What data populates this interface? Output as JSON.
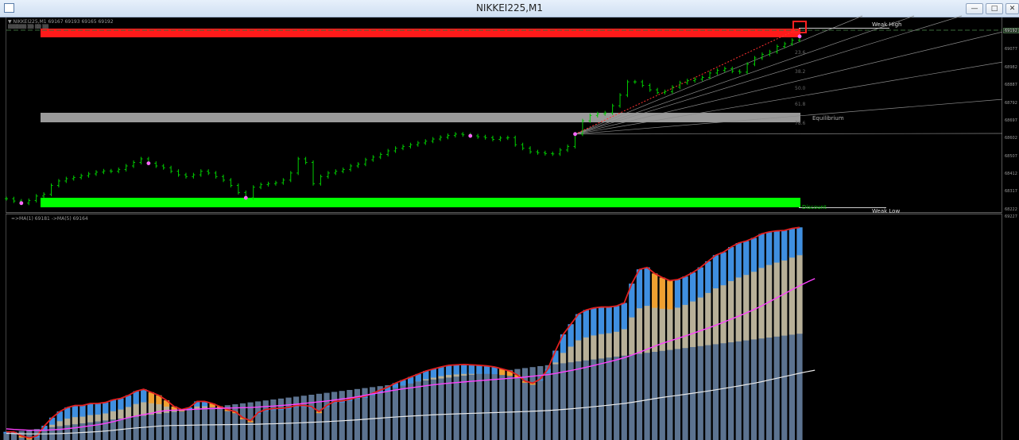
{
  "window": {
    "title": "NIKKEI225,M1"
  },
  "info_line": "▼ NIKKEI225,M1  69167 69193 69165 69192",
  "info_line2": "▒▒▒▒▒▒  ▒▒  ▒▒ ▒▒",
  "indicator_info": "=>MA(1) 69181  ->MA(5) 69164",
  "zones": {
    "weak_high": "Weak High",
    "equilibrium": "Equilibrium",
    "discount": "Discount",
    "weak_low": "Weak Low"
  },
  "fib_levels": [
    "23.6",
    "38.2",
    "50.0",
    "61.8",
    "78.6"
  ],
  "price_axis": {
    "current": "69192",
    "ticks": [
      "69172",
      "69077",
      "68982",
      "68887",
      "68792",
      "68697",
      "68602",
      "68507",
      "68412",
      "68317",
      "68222",
      "69227"
    ]
  },
  "colors": {
    "supply_zone": "#ff1a1a",
    "equilibrium_zone": "#9a9a9a",
    "demand_zone": "#00ff00",
    "candles": "#00cc00",
    "pivot": "#ff66ff",
    "fib_ray": "#aaaaaa",
    "hist_blue": "#3f8fe0",
    "hist_khaki": "#b8b098",
    "hist_steel": "#5c7390",
    "hist_orange": "#f0a030",
    "ma_red": "#e02020",
    "ma_magenta": "#ff40ff",
    "ma_white": "#e8e8e8"
  },
  "chart_data": {
    "type": "line",
    "price_pane": {
      "series": [
        {
          "values": [
            68275,
            68262,
            68250,
            68265,
            68290,
            68300,
            68350,
            68375,
            68388,
            68395,
            68405,
            68415,
            68425,
            68432,
            68430,
            68440,
            68460,
            68480,
            68500,
            68475,
            68460,
            68450,
            68430,
            68410,
            68400,
            68410,
            68430,
            68420,
            68400,
            68380,
            68350,
            68310,
            68280,
            68340,
            68355,
            68360,
            68365,
            68380,
            68420,
            68500,
            68480,
            68360,
            68400,
            68420,
            68430,
            68440,
            68460,
            68470,
            68495,
            68510,
            68525,
            68545,
            68560,
            68570,
            68580,
            68590,
            68600,
            68612,
            68622,
            68632,
            68640,
            68636,
            68630,
            68625,
            68620,
            68610,
            68618,
            68620,
            68580,
            68560,
            68540,
            68535,
            68530,
            68528,
            68550,
            68570,
            68640,
            68715,
            68745,
            68755,
            68760,
            68800,
            68860,
            68935,
            68935,
            68915,
            68890,
            68875,
            68880,
            68905,
            68930,
            68942,
            68950,
            68960,
            68985,
            69000,
            69010,
            68995,
            68990,
            69035,
            69070,
            69090,
            69105,
            69135,
            69150,
            69170,
            69192
          ]
        }
      ]
    },
    "indicator_pane": {
      "series": [
        {
          "name": "MA(1)",
          "values": [
            68220,
            68220,
            68200,
            68190,
            68200,
            68250,
            68290,
            68320,
            68340,
            68350,
            68350,
            68360,
            68360,
            68365,
            68378,
            68385,
            68400,
            68420,
            68430,
            68415,
            68400,
            68375,
            68345,
            68330,
            68340,
            68370,
            68370,
            68360,
            68345,
            68330,
            68320,
            68290,
            68275,
            68315,
            68330,
            68335,
            68336,
            68340,
            68350,
            68350,
            68345,
            68320,
            68350,
            68370,
            68372,
            68380,
            68390,
            68395,
            68410,
            68425,
            68440,
            68460,
            68475,
            68490,
            68505,
            68520,
            68530,
            68540,
            68548,
            68550,
            68552,
            68550,
            68548,
            68545,
            68540,
            68530,
            68520,
            68500,
            68470,
            68460,
            68480,
            68530,
            68620,
            68700,
            68750,
            68800,
            68820,
            68830,
            68835,
            68835,
            68840,
            68855,
            68950,
            69020,
            69030,
            69000,
            68980,
            68965,
            68970,
            68985,
            69005,
            69030,
            69060,
            69090,
            69105,
            69130,
            69150,
            69160,
            69175,
            69195,
            69205,
            69210,
            69212,
            69222,
            69227
          ]
        },
        {
          "name": "MA(5)",
          "values": [
            68235,
            68232,
            68230,
            68228,
            68228,
            68228,
            68230,
            68232,
            68236,
            68240,
            68245,
            68250,
            68255,
            68262,
            68270,
            68280,
            68290,
            68298,
            68305,
            68312,
            68320,
            68325,
            68327,
            68328,
            68330,
            68332,
            68334,
            68335,
            68336,
            68337,
            68338,
            68339,
            68340,
            68342,
            68345,
            68347,
            68350,
            68353,
            68356,
            68360,
            68364,
            68368,
            68372,
            68377,
            68382,
            68387,
            68393,
            68400,
            68407,
            68413,
            68420,
            68426,
            68432,
            68437,
            68442,
            68447,
            68452,
            68456,
            68460,
            68463,
            68466,
            68469,
            68472,
            68475,
            68478,
            68481,
            68484,
            68487,
            68490,
            68494,
            68498,
            68502,
            68508,
            68515,
            68522,
            68530,
            68538,
            68547,
            68556,
            68565,
            68575,
            68585,
            68598,
            68612,
            68627,
            68642,
            68656,
            68668,
            68680,
            68692,
            68705,
            68718,
            68731,
            68745,
            68760,
            68775,
            68790,
            68806,
            68822,
            68840,
            68860,
            68880,
            68900,
            68920,
            68940,
            68958,
            68975
          ]
        }
      ]
    }
  }
}
